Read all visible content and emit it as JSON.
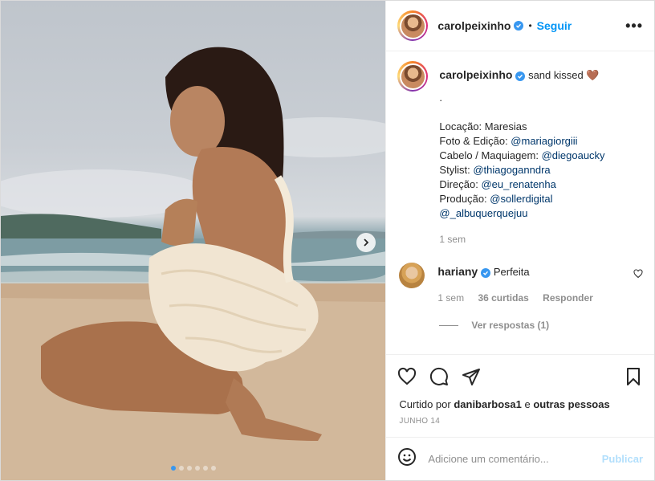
{
  "post": {
    "author": "carolpeixinho",
    "follow_label": "Seguir",
    "separator": "•",
    "more_label": "•••",
    "carousel": {
      "slide_count": 6,
      "active_index": 0
    }
  },
  "caption": {
    "author": "carolpeixinho",
    "text": "sand kissed",
    "emoji": "🤎",
    "dot_line": ".",
    "lines": [
      {
        "label": "Locação: ",
        "value": "Maresias",
        "is_link": false
      },
      {
        "label": "Foto & Edição: ",
        "value": "@mariagiorgiii",
        "is_link": true
      },
      {
        "label": "Cabelo / Maquiagem: ",
        "value": "@diegoaucky",
        "is_link": true
      },
      {
        "label": "Stylist: ",
        "value": "@thiagoganndra",
        "is_link": true
      },
      {
        "label": "Direção: ",
        "value": "@eu_renatenha",
        "is_link": true
      },
      {
        "label": "Produção: ",
        "value": "@sollerdigital",
        "is_link": true
      },
      {
        "label": "",
        "value": "@_albuquerquejuu",
        "is_link": true
      }
    ],
    "time": "1 sem"
  },
  "comment": {
    "author": "hariany",
    "text": "Perfeita",
    "time": "1 sem",
    "likes": "36 curtidas",
    "reply_label": "Responder",
    "view_replies": "Ver respostas (1)"
  },
  "likes": {
    "prefix": "Curtido por ",
    "user": "danibarbosa1",
    "middle": " e ",
    "others": "outras pessoas"
  },
  "date": "JUNHO 14",
  "add_comment": {
    "placeholder": "Adicione um comentário...",
    "publish_label": "Publicar"
  },
  "colors": {
    "accent": "#0095f6",
    "verified": "#3897f0",
    "link": "#00376b",
    "muted": "#8e8e8e",
    "publish_disabled": "#b2dffc"
  },
  "icons": [
    "heart-icon",
    "comment-icon",
    "share-icon",
    "bookmark-icon",
    "emoji-icon",
    "chevron-right-icon",
    "verified-icon",
    "more-icon"
  ]
}
